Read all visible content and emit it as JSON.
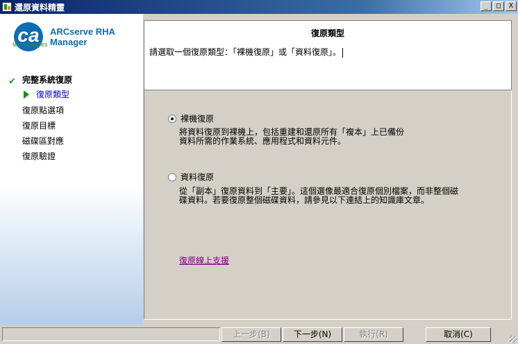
{
  "window": {
    "title": "還原資料精靈",
    "minimize": "_",
    "maximize": "□",
    "close": "X"
  },
  "sidebar": {
    "logo_text": "ca",
    "logo_sub": "technologies",
    "product_line1": "ARCserve RHA",
    "product_line2": "Manager",
    "root_item": "完整系統復原",
    "current_item": "復原類型",
    "items": [
      "復原點選項",
      "復原目標",
      "磁碟區對應",
      "復原驗證"
    ]
  },
  "header": {
    "title": "復原類型",
    "description": "請選取一個復原類型：「裸機復原」或「資料復原」。"
  },
  "options": [
    {
      "label": "裸機復原",
      "checked": true,
      "desc_line1": "將資料復原到裸機上，包括重建和還原所有「複本」上已備份",
      "desc_line2": "資料所需的作業系統、應用程式和資料元件。"
    },
    {
      "label": "資料復原",
      "checked": false,
      "desc_line1": "從「副本」復原資料到「主要」。這個選像最適合復原個別檔案，而非整個磁",
      "desc_line2": "碟資料。若要復原整個磁碟資料，請參見以下連結上的知識庫文章。"
    }
  ],
  "link": "復原線上支援",
  "buttons": {
    "back": "上一步(B)",
    "next": "下一步(N)",
    "run": "執行(R)",
    "cancel": "取消(C)"
  }
}
